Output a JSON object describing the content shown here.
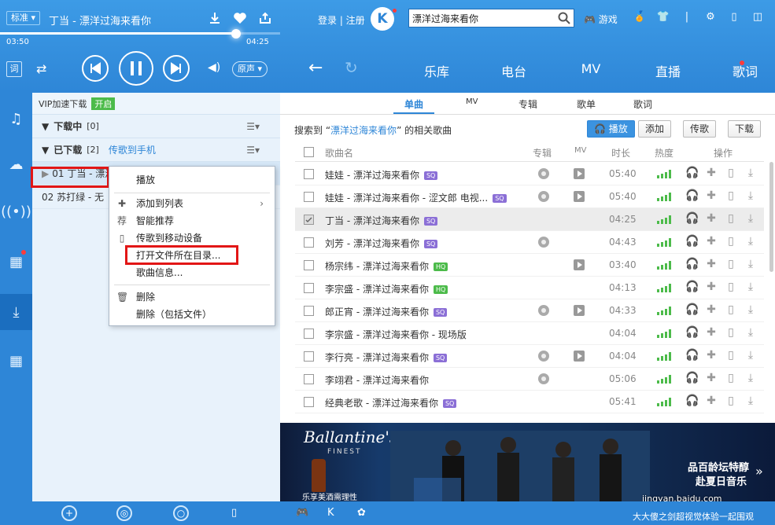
{
  "player": {
    "quality": "标准",
    "track_title": "丁当 - 漂洋过海来看你",
    "time_current": "03:50",
    "time_total": "04:25",
    "progress": 0.87,
    "lyric_btn": "词",
    "sound_mode": "原声"
  },
  "topbar": {
    "login": "登录 | 注册",
    "logo_letter": "K",
    "search_value": "漂洋过海来看你",
    "game": "游戏",
    "tabs": [
      "乐库",
      "电台",
      "MV",
      "直播",
      "歌词"
    ]
  },
  "subtabs": [
    "单曲",
    "MV",
    "专辑",
    "歌单",
    "歌词"
  ],
  "results": {
    "prefix": "搜索到 “",
    "keyword": "漂洋过海来看你",
    "suffix": "” 的相关歌曲",
    "buttons": [
      "播放",
      "添加",
      "传歌",
      "下载"
    ]
  },
  "table": {
    "headers": [
      "歌曲名",
      "专辑",
      "MV",
      "时长",
      "热度",
      "操作"
    ],
    "rows": [
      {
        "title": "娃娃 - 漂洋过海来看你",
        "badge": "SQ",
        "album": true,
        "mv": true,
        "duration": "05:40"
      },
      {
        "title": "娃娃 - 漂洋过海来看你 - 涩文郎 电视...",
        "badge": "SQ",
        "album": true,
        "mv": true,
        "duration": "05:40"
      },
      {
        "title": "丁当 - 漂洋过海来看你",
        "badge": "SQ",
        "album": false,
        "mv": false,
        "duration": "04:25",
        "selected": true
      },
      {
        "title": "刘芳 - 漂洋过海来看你",
        "badge": "SQ",
        "album": true,
        "mv": false,
        "duration": "04:43"
      },
      {
        "title": "杨宗纬 - 漂洋过海来看你",
        "badge": "HQ",
        "album": false,
        "mv": true,
        "duration": "03:40"
      },
      {
        "title": "李宗盛 - 漂洋过海来看你",
        "badge": "HQ",
        "album": false,
        "mv": false,
        "duration": "04:13"
      },
      {
        "title": "郎正宵 - 漂洋过海来看你",
        "badge": "SQ",
        "album": true,
        "mv": true,
        "duration": "04:33"
      },
      {
        "title": "李宗盛 - 漂洋过海来看你 - 现场版",
        "badge": "",
        "album": false,
        "mv": false,
        "duration": "04:04"
      },
      {
        "title": "李行亮 - 漂洋过海来看你",
        "badge": "SQ",
        "album": true,
        "mv": true,
        "duration": "04:04"
      },
      {
        "title": "李翊君 - 漂洋过海来看你",
        "badge": "",
        "album": true,
        "mv": false,
        "duration": "05:06"
      },
      {
        "title": "经典老歌 - 漂洋过海来看你",
        "badge": "SQ",
        "album": false,
        "mv": false,
        "duration": "05:41"
      }
    ]
  },
  "download": {
    "vip_label": "VIP加速下载",
    "vip_badge": "开启",
    "downloading": "下载中",
    "downloading_count": "[0]",
    "downloaded": "已下载",
    "downloaded_count": "[2]",
    "send_link": "传歌到手机",
    "items": [
      "01 丁当 - 漂洋过海来看你",
      "02 苏打绿 - 无"
    ]
  },
  "context_menu": [
    "播放",
    "添加到列表",
    "智能推荐",
    "传歌到移动设备",
    "打开文件所在目录...",
    "歌曲信息...",
    "删除",
    "删除（包括文件）"
  ],
  "ad": {
    "brand": "Ballantine's",
    "finest": "FINEST",
    "slogan": "乐享美酒需理性",
    "tag1": "品百龄坛特醇",
    "tag2": "赴夏日音乐"
  },
  "watermark": "大大傻之剑超视觉体验一起围观",
  "watermark_top": "jingyan.baidu.com"
}
